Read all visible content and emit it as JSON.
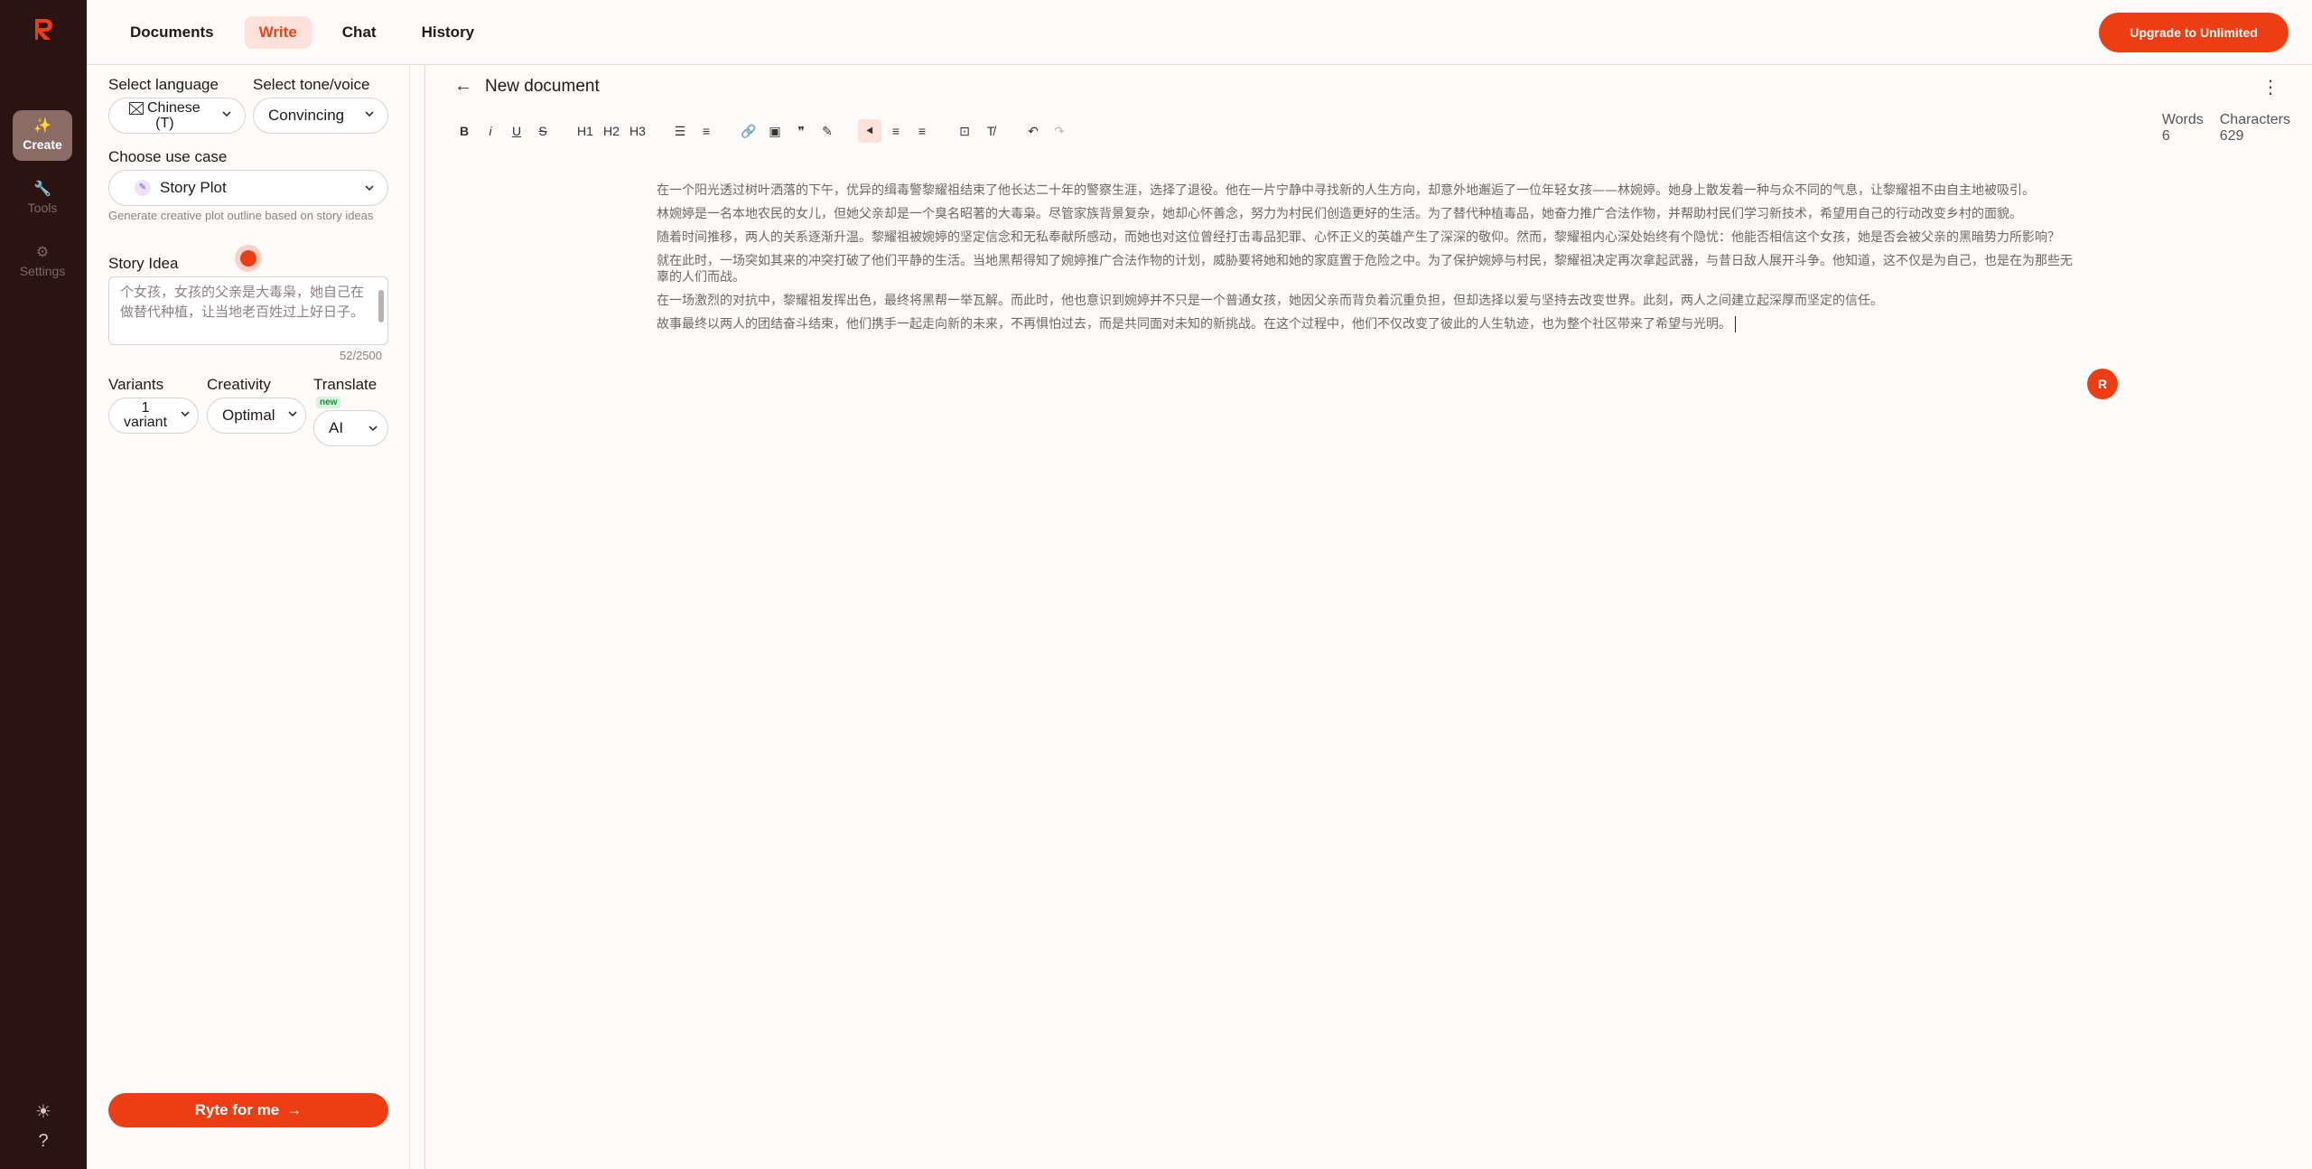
{
  "app": {
    "brand_color": "#ec3d14",
    "rail_color": "#2a1310"
  },
  "rail": {
    "items": [
      {
        "label": "Create",
        "icon": "sparkle-icon",
        "active": true
      },
      {
        "label": "Tools",
        "icon": "wrench-icon",
        "active": false
      },
      {
        "label": "Settings",
        "icon": "sliders-icon",
        "active": false
      }
    ],
    "bottom_icons": [
      "sun-icon",
      "help-icon"
    ]
  },
  "topnav": {
    "items": [
      "Documents",
      "Write",
      "Chat",
      "History"
    ],
    "active": "Write",
    "upgrade_label": "Upgrade to Unlimited"
  },
  "sidebar": {
    "language_label": "Select language",
    "language_value_1": "Chinese",
    "language_value_2": "(T)",
    "tone_label": "Select tone/voice",
    "tone_value": "Convincing",
    "use_case_label": "Choose use case",
    "use_case_value": "Story Plot",
    "use_case_hint": "Generate creative plot outline based on story ideas",
    "story_idea_label": "Story Idea",
    "story_idea_text": "个女孩，女孩的父亲是大毒枭，她自己在做替代种植，让当地老百姓过上好日子。",
    "counter": "52/2500",
    "variants_label": "Variants",
    "variants_value_1": "1",
    "variants_value_2": "variant",
    "creativity_label": "Creativity",
    "creativity_value": "Optimal",
    "translate_label": "Translate",
    "translate_badge": "new",
    "translate_value": "AI",
    "ryte_label": "Ryte for me"
  },
  "editor": {
    "title": "New document",
    "toolbar": [
      "B",
      "i",
      "U",
      "S",
      "H1",
      "H2",
      "H3"
    ],
    "words_label": "Words",
    "words_value": "6",
    "chars_label": "Characters",
    "chars_value": "629",
    "paragraphs": [
      "在一个阳光透过树叶洒落的下午，优异的缉毒警黎耀祖结束了他长达二十年的警察生涯，选择了退役。他在一片宁静中寻找新的人生方向，却意外地邂逅了一位年轻女孩——林婉婷。她身上散发着一种与众不同的气息，让黎耀祖不由自主地被吸引。",
      "林婉婷是一名本地农民的女儿，但她父亲却是一个臭名昭著的大毒枭。尽管家族背景复杂，她却心怀善念，努力为村民们创造更好的生活。为了替代种植毒品，她奋力推广合法作物，并帮助村民们学习新技术，希望用自己的行动改变乡村的面貌。",
      "随着时间推移，两人的关系逐渐升温。黎耀祖被婉婷的坚定信念和无私奉献所感动，而她也对这位曾经打击毒品犯罪、心怀正义的英雄产生了深深的敬仰。然而，黎耀祖内心深处始终有个隐忧：他能否相信这个女孩，她是否会被父亲的黑暗势力所影响？",
      "就在此时，一场突如其来的冲突打破了他们平静的生活。当地黑帮得知了婉婷推广合法作物的计划，威胁要将她和她的家庭置于危险之中。为了保护婉婷与村民，黎耀祖决定再次拿起武器，与昔日敌人展开斗争。他知道，这不仅是为自己，也是在为那些无辜的人们而战。",
      "在一场激烈的对抗中，黎耀祖发挥出色，最终将黑帮一举瓦解。而此时，他也意识到婉婷并不只是一个普通女孩，她因父亲而背负着沉重负担，但却选择以爱与坚持去改变世界。此刻，两人之间建立起深厚而坚定的信任。",
      "故事最终以两人的团结奋斗结束，他们携手一起走向新的未来，不再惧怕过去，而是共同面对未知的新挑战。在这个过程中，他们不仅改变了彼此的人生轨迹，也为整个社区带来了希望与光明。"
    ]
  }
}
